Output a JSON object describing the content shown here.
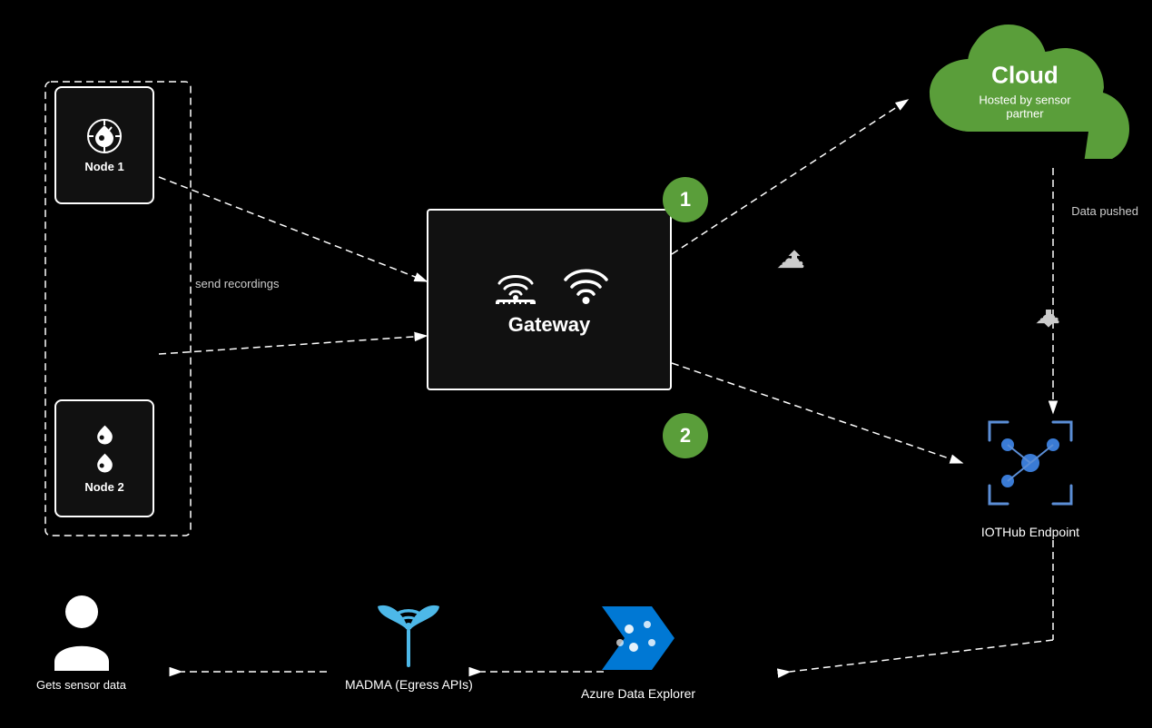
{
  "cloud": {
    "title": "Cloud",
    "subtitle": "Hosted by sensor partner"
  },
  "nodes": {
    "node1": {
      "label": "Node 1"
    },
    "node2": {
      "label": "Node 2"
    }
  },
  "gateway": {
    "label": "Gateway"
  },
  "steps": {
    "step1": "1",
    "step2": "2"
  },
  "labels": {
    "send_recordings": "send recordings",
    "data_pushed": "Data pushed",
    "iothub": "IOTHub Endpoint",
    "madma": "MADMA  (Egress APIs)",
    "azure": "Azure Data Explorer",
    "gets_sensor_data": "Gets sensor data"
  },
  "colors": {
    "green": "#5a9e3a",
    "white": "#ffffff",
    "dark_bg": "#111111",
    "arrow": "#ffffff"
  }
}
